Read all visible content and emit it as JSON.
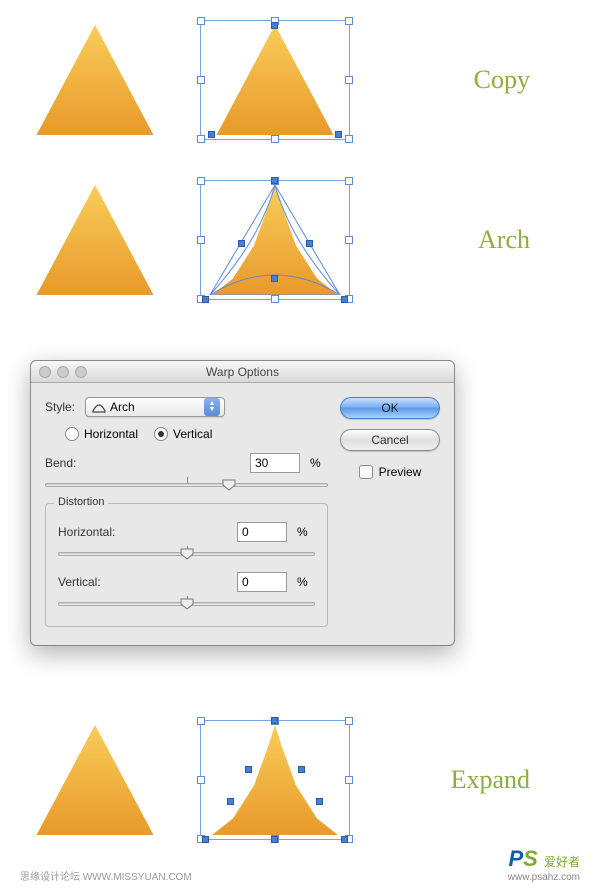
{
  "rows": {
    "copy": "Copy",
    "arch": "Arch",
    "expand": "Expand"
  },
  "dialog": {
    "title": "Warp Options",
    "style_label": "Style:",
    "style_value": "Arch",
    "horizontal_label": "Horizontal",
    "vertical_label": "Vertical",
    "orientation_selected": "vertical",
    "bend_label": "Bend:",
    "bend_value": "30",
    "percent": "%",
    "distortion_legend": "Distortion",
    "dist_h_label": "Horizontal:",
    "dist_h_value": "0",
    "dist_v_label": "Vertical:",
    "dist_v_value": "0",
    "ok": "OK",
    "cancel": "Cancel",
    "preview": "Preview"
  },
  "footer": {
    "left": "思缘设计论坛  WWW.MISSYUAN.COM",
    "right_sub": "爱好者",
    "right_url": "www.psahz.com"
  }
}
